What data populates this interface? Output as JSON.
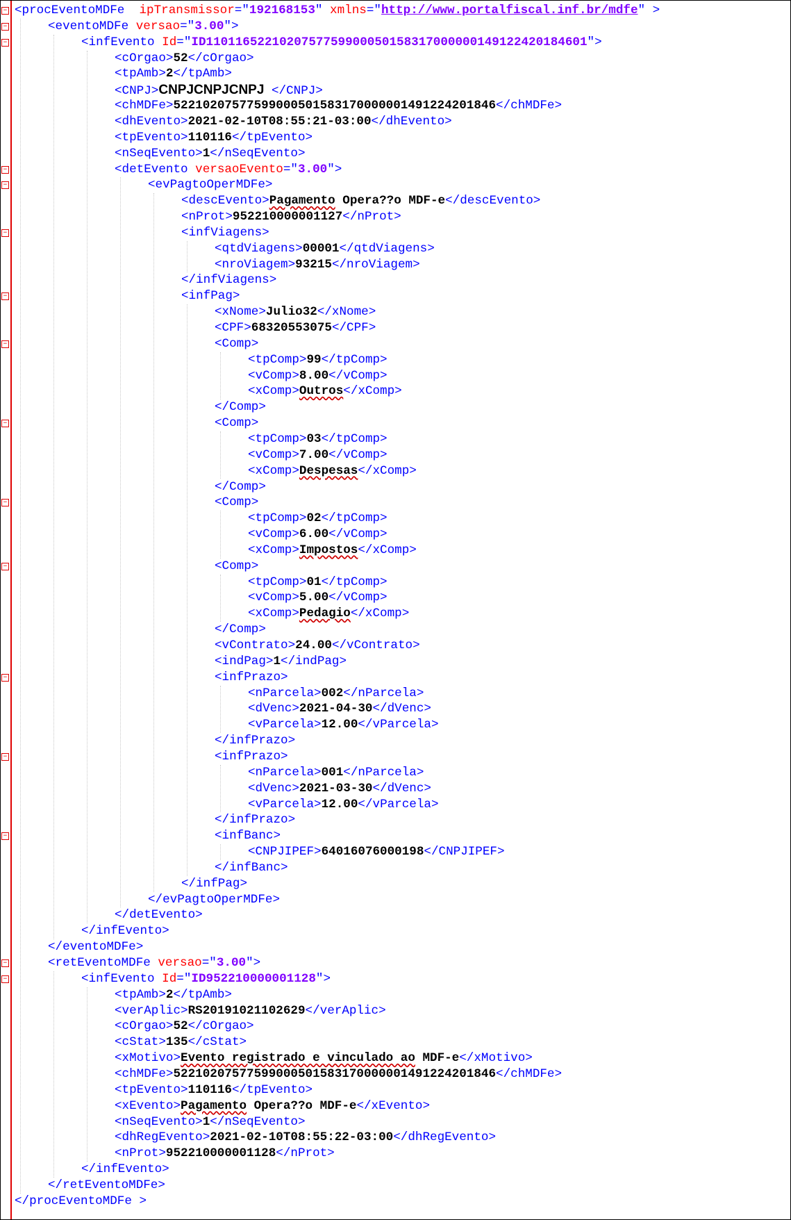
{
  "lines": [
    {
      "indent": 0,
      "fold": true,
      "parts": [
        [
          "tag",
          "<procEventoMDFe  "
        ],
        [
          "attr",
          "ipTransmissor"
        ],
        [
          "tag",
          "=\""
        ],
        [
          "aval",
          "192168153"
        ],
        [
          "tag",
          "\" "
        ],
        [
          "attr",
          "xmlns"
        ],
        [
          "tag",
          "=\""
        ],
        [
          "aval url",
          "http://www.portalfiscal.inf.br/mdfe"
        ],
        [
          "tag",
          "\" >"
        ]
      ]
    },
    {
      "indent": 1,
      "fold": true,
      "parts": [
        [
          "tag",
          "<eventoMDFe "
        ],
        [
          "attr",
          "versao"
        ],
        [
          "tag",
          "=\""
        ],
        [
          "aval",
          "3.00"
        ],
        [
          "tag",
          "\">"
        ]
      ]
    },
    {
      "indent": 2,
      "fold": true,
      "parts": [
        [
          "tag",
          "<infEvento "
        ],
        [
          "attr",
          "Id"
        ],
        [
          "tag",
          "=\""
        ],
        [
          "aval",
          "ID1101165221020757759900050158317000000149122420184601"
        ],
        [
          "tag",
          "\">"
        ]
      ]
    },
    {
      "indent": 3,
      "parts": [
        [
          "tag",
          "<cOrgao>"
        ],
        [
          "txt",
          "52"
        ],
        [
          "tag",
          "</cOrgao>"
        ]
      ]
    },
    {
      "indent": 3,
      "parts": [
        [
          "tag",
          "<tpAmb>"
        ],
        [
          "txt",
          "2"
        ],
        [
          "tag",
          "</tpAmb>"
        ]
      ]
    },
    {
      "indent": 3,
      "parts": [
        [
          "tag",
          "<CNPJ>"
        ],
        [
          "big",
          "CNPJCNPJCNPJ"
        ],
        [
          "tag",
          " </CNPJ>"
        ]
      ]
    },
    {
      "indent": 3,
      "parts": [
        [
          "tag",
          "<chMDFe>"
        ],
        [
          "txt",
          "52210207577599000501583170000001491224201846"
        ],
        [
          "tag",
          "</chMDFe>"
        ]
      ]
    },
    {
      "indent": 3,
      "parts": [
        [
          "tag",
          "<dhEvento>"
        ],
        [
          "txt",
          "2021-02-10T08:55:21-03:00"
        ],
        [
          "tag",
          "</dhEvento>"
        ]
      ]
    },
    {
      "indent": 3,
      "parts": [
        [
          "tag",
          "<tpEvento>"
        ],
        [
          "txt",
          "110116"
        ],
        [
          "tag",
          "</tpEvento>"
        ]
      ]
    },
    {
      "indent": 3,
      "parts": [
        [
          "tag",
          "<nSeqEvento>"
        ],
        [
          "txt",
          "1"
        ],
        [
          "tag",
          "</nSeqEvento>"
        ]
      ]
    },
    {
      "indent": 3,
      "fold": true,
      "parts": [
        [
          "tag",
          "<detEvento "
        ],
        [
          "attr",
          "versaoEvento"
        ],
        [
          "tag",
          "=\""
        ],
        [
          "aval",
          "3.00"
        ],
        [
          "tag",
          "\">"
        ]
      ]
    },
    {
      "indent": 4,
      "fold": true,
      "parts": [
        [
          "tag",
          "<evPagtoOperMDFe>"
        ]
      ]
    },
    {
      "indent": 5,
      "parts": [
        [
          "tag",
          "<descEvento>"
        ],
        [
          "txt sq",
          "Pagamento"
        ],
        [
          "txt",
          " Opera??o MDF-e"
        ],
        [
          "tag",
          "</descEvento>"
        ]
      ]
    },
    {
      "indent": 5,
      "parts": [
        [
          "tag",
          "<nProt>"
        ],
        [
          "txt",
          "952210000001127"
        ],
        [
          "tag",
          "</nProt>"
        ]
      ]
    },
    {
      "indent": 5,
      "fold": true,
      "parts": [
        [
          "tag",
          "<infViagens>"
        ]
      ]
    },
    {
      "indent": 6,
      "parts": [
        [
          "tag",
          "<qtdViagens>"
        ],
        [
          "txt",
          "00001"
        ],
        [
          "tag",
          "</qtdViagens>"
        ]
      ]
    },
    {
      "indent": 6,
      "parts": [
        [
          "tag",
          "<nroViagem>"
        ],
        [
          "txt",
          "93215"
        ],
        [
          "tag",
          "</nroViagem>"
        ]
      ]
    },
    {
      "indent": 5,
      "parts": [
        [
          "tag",
          "</infViagens>"
        ]
      ]
    },
    {
      "indent": 5,
      "fold": true,
      "parts": [
        [
          "tag",
          "<infPag>"
        ]
      ]
    },
    {
      "indent": 6,
      "parts": [
        [
          "tag",
          "<xNome>"
        ],
        [
          "txt",
          "Julio32"
        ],
        [
          "tag",
          "</xNome>"
        ]
      ]
    },
    {
      "indent": 6,
      "parts": [
        [
          "tag",
          "<CPF>"
        ],
        [
          "txt",
          "68320553075"
        ],
        [
          "tag",
          "</CPF>"
        ]
      ]
    },
    {
      "indent": 6,
      "fold": true,
      "parts": [
        [
          "tag",
          "<Comp>"
        ]
      ]
    },
    {
      "indent": 7,
      "parts": [
        [
          "tag",
          "<tpComp>"
        ],
        [
          "txt",
          "99"
        ],
        [
          "tag",
          "</tpComp>"
        ]
      ]
    },
    {
      "indent": 7,
      "parts": [
        [
          "tag",
          "<vComp>"
        ],
        [
          "txt",
          "8.00"
        ],
        [
          "tag",
          "</vComp>"
        ]
      ]
    },
    {
      "indent": 7,
      "parts": [
        [
          "tag",
          "<xComp>"
        ],
        [
          "txt sq",
          "Outros"
        ],
        [
          "tag",
          "</xComp>"
        ]
      ]
    },
    {
      "indent": 6,
      "parts": [
        [
          "tag",
          "</Comp>"
        ]
      ]
    },
    {
      "indent": 6,
      "fold": true,
      "parts": [
        [
          "tag",
          "<Comp>"
        ]
      ]
    },
    {
      "indent": 7,
      "parts": [
        [
          "tag",
          "<tpComp>"
        ],
        [
          "txt",
          "03"
        ],
        [
          "tag",
          "</tpComp>"
        ]
      ]
    },
    {
      "indent": 7,
      "parts": [
        [
          "tag",
          "<vComp>"
        ],
        [
          "txt",
          "7.00"
        ],
        [
          "tag",
          "</vComp>"
        ]
      ]
    },
    {
      "indent": 7,
      "parts": [
        [
          "tag",
          "<xComp>"
        ],
        [
          "txt sq",
          "Despesas"
        ],
        [
          "tag",
          "</xComp>"
        ]
      ]
    },
    {
      "indent": 6,
      "parts": [
        [
          "tag",
          "</Comp>"
        ]
      ]
    },
    {
      "indent": 6,
      "fold": true,
      "parts": [
        [
          "tag",
          "<Comp>"
        ]
      ]
    },
    {
      "indent": 7,
      "parts": [
        [
          "tag",
          "<tpComp>"
        ],
        [
          "txt",
          "02"
        ],
        [
          "tag",
          "</tpComp>"
        ]
      ]
    },
    {
      "indent": 7,
      "parts": [
        [
          "tag",
          "<vComp>"
        ],
        [
          "txt",
          "6.00"
        ],
        [
          "tag",
          "</vComp>"
        ]
      ]
    },
    {
      "indent": 7,
      "parts": [
        [
          "tag",
          "<xComp>"
        ],
        [
          "txt sq",
          "Impostos"
        ],
        [
          "tag",
          "</xComp>"
        ]
      ]
    },
    {
      "indent": 6,
      "fold": true,
      "parts": [
        [
          "tag",
          "<Comp>"
        ]
      ]
    },
    {
      "indent": 7,
      "parts": [
        [
          "tag",
          "<tpComp>"
        ],
        [
          "txt",
          "01"
        ],
        [
          "tag",
          "</tpComp>"
        ]
      ]
    },
    {
      "indent": 7,
      "parts": [
        [
          "tag",
          "<vComp>"
        ],
        [
          "txt",
          "5.00"
        ],
        [
          "tag",
          "</vComp>"
        ]
      ]
    },
    {
      "indent": 7,
      "parts": [
        [
          "tag",
          "<xComp>"
        ],
        [
          "txt sq",
          "Pedagio"
        ],
        [
          "tag",
          "</xComp>"
        ]
      ]
    },
    {
      "indent": 6,
      "parts": [
        [
          "tag",
          "</Comp>"
        ]
      ]
    },
    {
      "indent": 6,
      "parts": [
        [
          "tag",
          "<vContrato>"
        ],
        [
          "txt",
          "24.00"
        ],
        [
          "tag",
          "</vContrato>"
        ]
      ]
    },
    {
      "indent": 6,
      "parts": [
        [
          "tag",
          "<indPag>"
        ],
        [
          "txt",
          "1"
        ],
        [
          "tag",
          "</indPag>"
        ]
      ]
    },
    {
      "indent": 6,
      "fold": true,
      "parts": [
        [
          "tag",
          "<infPrazo>"
        ]
      ]
    },
    {
      "indent": 7,
      "parts": [
        [
          "tag",
          "<nParcela>"
        ],
        [
          "txt",
          "002"
        ],
        [
          "tag",
          "</nParcela>"
        ]
      ]
    },
    {
      "indent": 7,
      "parts": [
        [
          "tag",
          "<dVenc>"
        ],
        [
          "txt",
          "2021-04-30"
        ],
        [
          "tag",
          "</dVenc>"
        ]
      ]
    },
    {
      "indent": 7,
      "parts": [
        [
          "tag",
          "<vParcela>"
        ],
        [
          "txt",
          "12.00"
        ],
        [
          "tag",
          "</vParcela>"
        ]
      ]
    },
    {
      "indent": 6,
      "parts": [
        [
          "tag",
          "</infPrazo>"
        ]
      ]
    },
    {
      "indent": 6,
      "fold": true,
      "parts": [
        [
          "tag",
          "<infPrazo>"
        ]
      ]
    },
    {
      "indent": 7,
      "parts": [
        [
          "tag",
          "<nParcela>"
        ],
        [
          "txt",
          "001"
        ],
        [
          "tag",
          "</nParcela>"
        ]
      ]
    },
    {
      "indent": 7,
      "parts": [
        [
          "tag",
          "<dVenc>"
        ],
        [
          "txt",
          "2021-03-30"
        ],
        [
          "tag",
          "</dVenc>"
        ]
      ]
    },
    {
      "indent": 7,
      "parts": [
        [
          "tag",
          "<vParcela>"
        ],
        [
          "txt",
          "12.00"
        ],
        [
          "tag",
          "</vParcela>"
        ]
      ]
    },
    {
      "indent": 6,
      "parts": [
        [
          "tag",
          "</infPrazo>"
        ]
      ]
    },
    {
      "indent": 6,
      "fold": true,
      "parts": [
        [
          "tag",
          "<infBanc>"
        ]
      ]
    },
    {
      "indent": 7,
      "parts": [
        [
          "tag",
          "<CNPJIPEF>"
        ],
        [
          "txt",
          "64016076000198"
        ],
        [
          "tag",
          "</CNPJIPEF>"
        ]
      ]
    },
    {
      "indent": 6,
      "parts": [
        [
          "tag",
          "</infBanc>"
        ]
      ]
    },
    {
      "indent": 5,
      "parts": [
        [
          "tag",
          "</infPag>"
        ]
      ]
    },
    {
      "indent": 4,
      "parts": [
        [
          "tag",
          "</evPagtoOperMDFe>"
        ]
      ]
    },
    {
      "indent": 3,
      "parts": [
        [
          "tag",
          "</detEvento>"
        ]
      ]
    },
    {
      "indent": 2,
      "parts": [
        [
          "tag",
          "</infEvento>"
        ]
      ]
    },
    {
      "indent": 1,
      "parts": [
        [
          "tag",
          "</eventoMDFe>"
        ]
      ]
    },
    {
      "indent": 1,
      "fold": true,
      "parts": [
        [
          "tag",
          "<retEventoMDFe "
        ],
        [
          "attr",
          "versao"
        ],
        [
          "tag",
          "=\""
        ],
        [
          "aval",
          "3.00"
        ],
        [
          "tag",
          "\">"
        ]
      ]
    },
    {
      "indent": 2,
      "fold": true,
      "parts": [
        [
          "tag",
          "<infEvento "
        ],
        [
          "attr",
          "Id"
        ],
        [
          "tag",
          "=\""
        ],
        [
          "aval",
          "ID952210000001128"
        ],
        [
          "tag",
          "\">"
        ]
      ]
    },
    {
      "indent": 3,
      "parts": [
        [
          "tag",
          "<tpAmb>"
        ],
        [
          "txt",
          "2"
        ],
        [
          "tag",
          "</tpAmb>"
        ]
      ]
    },
    {
      "indent": 3,
      "parts": [
        [
          "tag",
          "<verAplic>"
        ],
        [
          "txt",
          "RS20191021102629"
        ],
        [
          "tag",
          "</verAplic>"
        ]
      ]
    },
    {
      "indent": 3,
      "parts": [
        [
          "tag",
          "<cOrgao>"
        ],
        [
          "txt",
          "52"
        ],
        [
          "tag",
          "</cOrgao>"
        ]
      ]
    },
    {
      "indent": 3,
      "parts": [
        [
          "tag",
          "<cStat>"
        ],
        [
          "txt",
          "135"
        ],
        [
          "tag",
          "</cStat>"
        ]
      ]
    },
    {
      "indent": 3,
      "parts": [
        [
          "tag",
          "<xMotivo>"
        ],
        [
          "txt sq",
          "Evento registrado e vinculado ao"
        ],
        [
          "txt",
          " MDF-e"
        ],
        [
          "tag",
          "</xMotivo>"
        ]
      ]
    },
    {
      "indent": 3,
      "parts": [
        [
          "tag",
          "<chMDFe>"
        ],
        [
          "txt",
          "52210207577599000501583170000001491224201846"
        ],
        [
          "tag",
          "</chMDFe>"
        ]
      ]
    },
    {
      "indent": 3,
      "parts": [
        [
          "tag",
          "<tpEvento>"
        ],
        [
          "txt",
          "110116"
        ],
        [
          "tag",
          "</tpEvento>"
        ]
      ]
    },
    {
      "indent": 3,
      "parts": [
        [
          "tag",
          "<xEvento>"
        ],
        [
          "txt sq",
          "Pagamento"
        ],
        [
          "txt",
          " Opera??o MDF-e"
        ],
        [
          "tag",
          "</xEvento>"
        ]
      ]
    },
    {
      "indent": 3,
      "parts": [
        [
          "tag",
          "<nSeqEvento>"
        ],
        [
          "txt",
          "1"
        ],
        [
          "tag",
          "</nSeqEvento>"
        ]
      ]
    },
    {
      "indent": 3,
      "parts": [
        [
          "tag",
          "<dhRegEvento>"
        ],
        [
          "txt",
          "2021-02-10T08:55:22-03:00"
        ],
        [
          "tag",
          "</dhRegEvento>"
        ]
      ]
    },
    {
      "indent": 3,
      "parts": [
        [
          "tag",
          "<nProt>"
        ],
        [
          "txt",
          "952210000001128"
        ],
        [
          "tag",
          "</nProt>"
        ]
      ]
    },
    {
      "indent": 2,
      "parts": [
        [
          "tag",
          "</infEvento>"
        ]
      ]
    },
    {
      "indent": 1,
      "parts": [
        [
          "tag",
          "</retEventoMDFe>"
        ]
      ]
    },
    {
      "indent": 0,
      "parts": [
        [
          "tag",
          "</procEventoMDFe >"
        ]
      ]
    }
  ]
}
